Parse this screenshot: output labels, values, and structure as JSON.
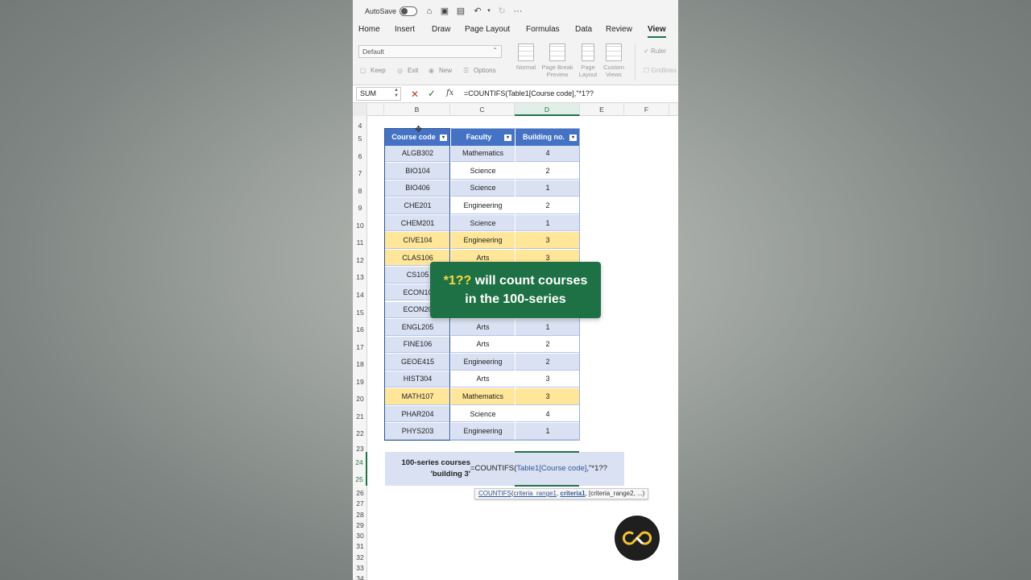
{
  "titlebar": {
    "autosave_label": "AutoSave",
    "more": "···"
  },
  "tabs": [
    "Home",
    "Insert",
    "Draw",
    "Page Layout",
    "Formulas",
    "Data",
    "Review",
    "View"
  ],
  "ribbon": {
    "sheet_view": "Default",
    "keep": "Keep",
    "exit": "Exit",
    "new": "New",
    "options": "Options",
    "normal": "Normal",
    "page_break_1": "Page Break",
    "page_break_2": "Preview",
    "page_layout_1": "Page",
    "page_layout_2": "Layout",
    "custom_1": "Custom",
    "custom_2": "Views",
    "ruler": "Ruler",
    "gridlines": "Gridlines"
  },
  "formula_bar": {
    "name_box": "SUM",
    "formula": "=COUNTIFS(Table1[Course code],\"*1??"
  },
  "columns": [
    "B",
    "C",
    "D",
    "E",
    "F"
  ],
  "rows": [
    "4",
    "5",
    "6",
    "7",
    "8",
    "9",
    "10",
    "11",
    "12",
    "13",
    "14",
    "15",
    "16",
    "17",
    "18",
    "19",
    "20",
    "21",
    "22",
    "23",
    "24",
    "25",
    "26",
    "27",
    "28",
    "29",
    "30",
    "31",
    "32",
    "33",
    "34"
  ],
  "table": {
    "headers": [
      "Course code",
      "Faculty",
      "Building no."
    ],
    "rows": [
      {
        "code": "ALGB302",
        "faculty": "Mathematics",
        "building": "4"
      },
      {
        "code": "BIO104",
        "faculty": "Science",
        "building": "2"
      },
      {
        "code": "BIO406",
        "faculty": "Science",
        "building": "1"
      },
      {
        "code": "CHE201",
        "faculty": "Engineering",
        "building": "2"
      },
      {
        "code": "CHEM201",
        "faculty": "Science",
        "building": "1"
      },
      {
        "code": "CIVE104",
        "faculty": "Engineering",
        "building": "3"
      },
      {
        "code": "CLAS106",
        "faculty": "Arts",
        "building": "3"
      },
      {
        "code": "CS105",
        "faculty": "",
        "building": ""
      },
      {
        "code": "ECON10",
        "faculty": "",
        "building": ""
      },
      {
        "code": "ECON20",
        "faculty": "",
        "building": ""
      },
      {
        "code": "ENGL205",
        "faculty": "Arts",
        "building": "1"
      },
      {
        "code": "FINE106",
        "faculty": "Arts",
        "building": "2"
      },
      {
        "code": "GEOE415",
        "faculty": "Engineering",
        "building": "2"
      },
      {
        "code": "HIST304",
        "faculty": "Arts",
        "building": "3"
      },
      {
        "code": "MATH107",
        "faculty": "Mathematics",
        "building": "3"
      },
      {
        "code": "PHAR204",
        "faculty": "Science",
        "building": "4"
      },
      {
        "code": "PHYS203",
        "faculty": "Engineering",
        "building": "1"
      }
    ]
  },
  "calc": {
    "label_line1": "100-series courses",
    "label_line2": "'building 3'",
    "formula_prefix": "=COUNTIFS(",
    "formula_ref": "Table1[Course code]",
    "formula_suffix": ",\"*1??"
  },
  "tooltip": {
    "fn": "COUNTIFS",
    "arg1": "criteria_range1",
    "arg2": "criteria1",
    "rest": "[criteria_range2, ...)"
  },
  "callout": {
    "accent": "*1??",
    "line1_rest": " will count courses",
    "line2": "in the 100-series"
  },
  "colors": {
    "excel_green": "#217346",
    "table_header": "#4472c4",
    "band": "#d9e1f2",
    "highlight": "#ffe699",
    "callout_bg": "#1e7145",
    "callout_accent": "#ffd83d"
  }
}
